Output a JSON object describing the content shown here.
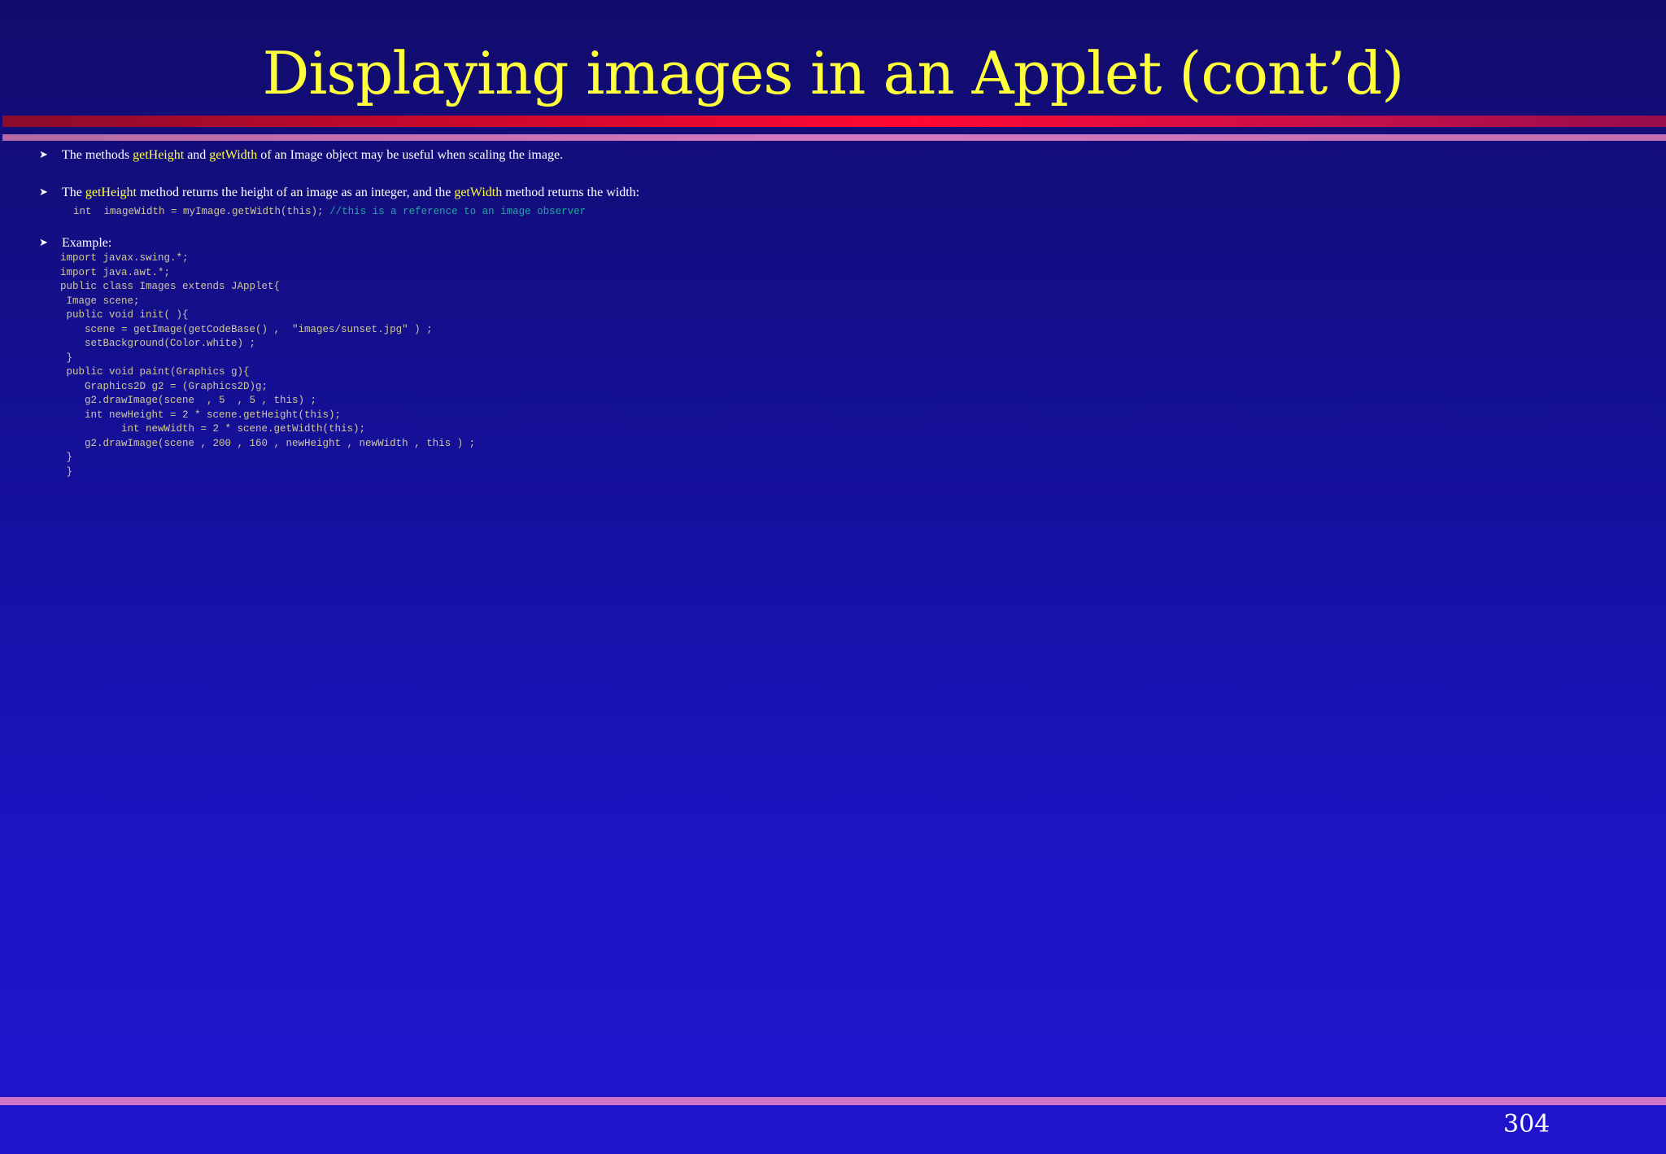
{
  "slide": {
    "title": "Displaying images in an Applet (cont’d)",
    "page_number": "304"
  },
  "bullets": [
    {
      "parts": [
        {
          "text": "The methods ",
          "hl": false
        },
        {
          "text": "getHeight",
          "hl": true
        },
        {
          "text": " and ",
          "hl": false
        },
        {
          "text": "getWidth",
          "hl": true
        },
        {
          "text": " of an Image object may be useful when scaling the image.",
          "hl": false
        }
      ]
    },
    {
      "parts": [
        {
          "text": "The ",
          "hl": false
        },
        {
          "text": "getHeight",
          "hl": true
        },
        {
          "text": " method returns the height of an image as an integer, and the ",
          "hl": false
        },
        {
          "text": "getWidth",
          "hl": true
        },
        {
          "text": " method returns the width:",
          "hl": false
        }
      ]
    },
    {
      "parts": [
        {
          "text": "Example:",
          "hl": false
        }
      ]
    }
  ],
  "snippet": {
    "code": "int  imageWidth = myImage.getWidth(this); ",
    "comment": "//this is a reference to an image observer"
  },
  "example_lines": [
    "import javax.swing.*;",
    "import java.awt.*;",
    "public class Images extends JApplet{",
    " Image scene;",
    " public void init( ){",
    "    scene = getImage(getCodeBase() ,  \"images/sunset.jpg\" ) ;",
    "    setBackground(Color.white) ;",
    " }",
    " public void paint(Graphics g){",
    "    Graphics2D g2 = (Graphics2D)g;",
    "    g2.drawImage(scene  , 5  , 5 , this) ;",
    "    int newHeight = 2 * scene.getHeight(this);",
    "          int newWidth = 2 * scene.getWidth(this);",
    "    g2.drawImage(scene , 200 , 160 , newHeight , newWidth , this ) ;",
    " }",
    " }"
  ],
  "icons": {
    "bullet": "arrowhead-bullet-icon"
  },
  "colors": {
    "title": "#ffff3c",
    "highlight": "#ffff3c",
    "comment": "#22a8a0",
    "accent_bar": "#ff0833",
    "pink_bar": "#d072c6"
  }
}
